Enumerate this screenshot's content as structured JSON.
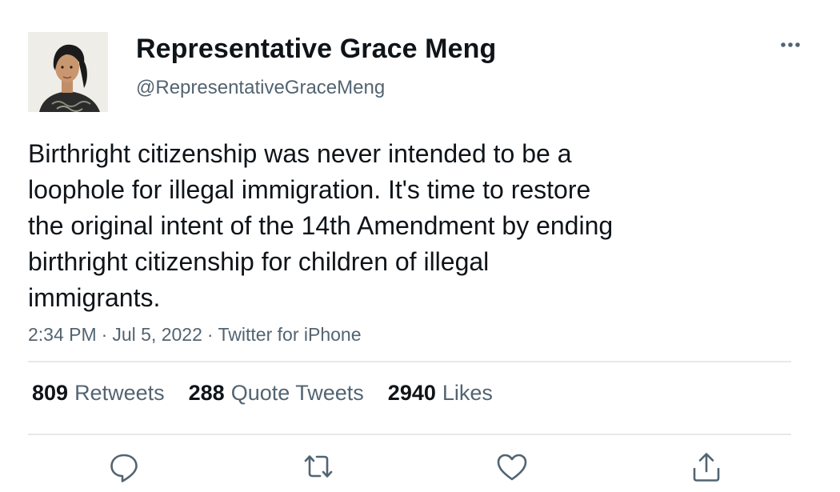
{
  "author": {
    "display_name": "Representative Grace Meng",
    "handle": "@RepresentativeGraceMeng",
    "avatar_icon": "profile-photo"
  },
  "tweet": {
    "lines": [
      "Birthright citizenship was never intended to be a",
      "loophole for illegal immigration. It's time to restore",
      "the original intent of the 14th Amendment by ending",
      "birthright citizenship for children of illegal",
      "immigrants."
    ]
  },
  "meta": {
    "time": "2:34 PM",
    "date": "Jul 5, 2022",
    "source": "Twitter for iPhone",
    "separator": "·"
  },
  "stats": {
    "retweets": {
      "count": "809",
      "label": "Retweets"
    },
    "quotes": {
      "count": "288",
      "label": "Quote Tweets"
    },
    "likes": {
      "count": "2940",
      "label": "Likes"
    }
  },
  "actions": [
    "reply-icon",
    "retweet-icon",
    "like-icon",
    "share-icon"
  ],
  "colors": {
    "text": "#0f1419",
    "secondary": "#536471",
    "divider": "#e6e9ea"
  }
}
